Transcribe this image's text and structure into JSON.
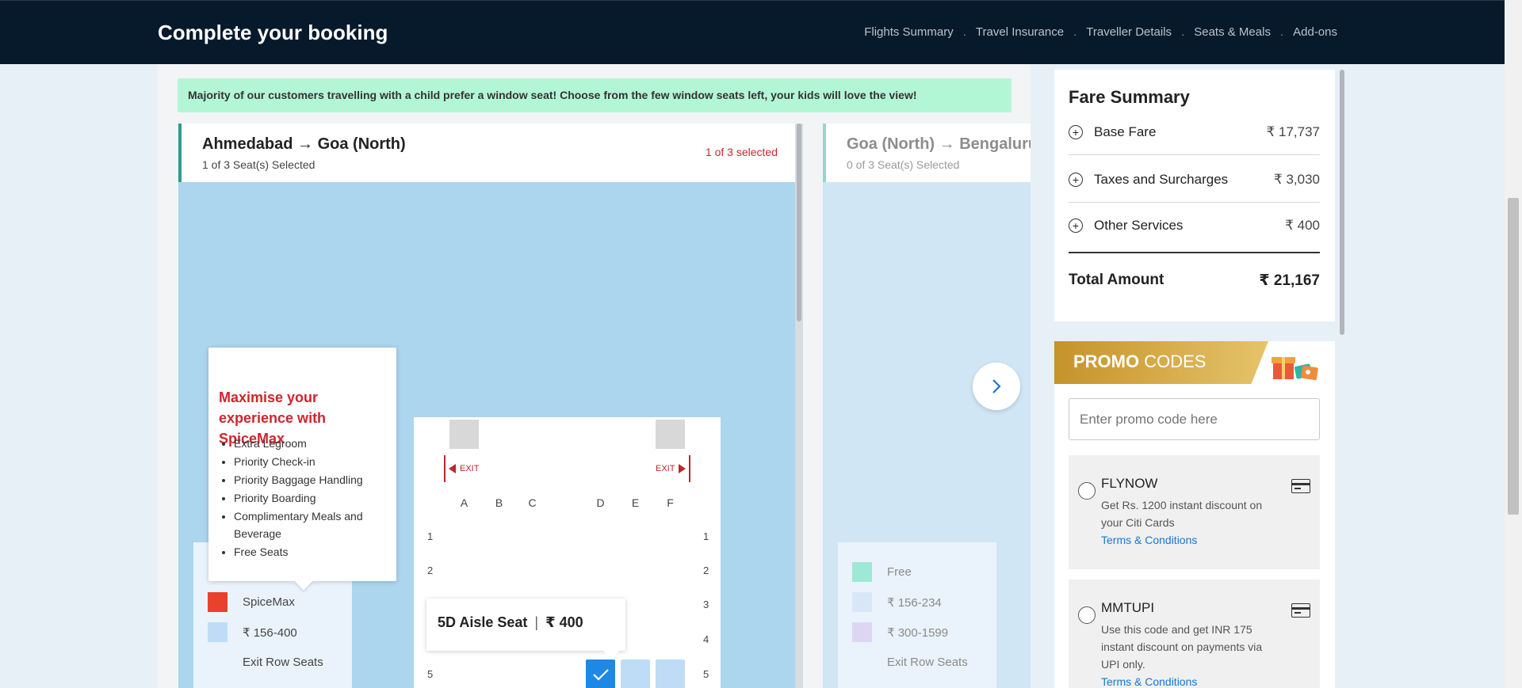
{
  "header": {
    "title": "Complete your booking",
    "steps": [
      "Flights Summary",
      "Travel Insurance",
      "Traveller Details",
      "Seats & Meals",
      "Add-ons"
    ]
  },
  "banner": "Majority of our customers travelling with a child prefer a window seat! Choose from the few window seats left, your kids will love the view!",
  "flight1": {
    "route": "Ahmedabad → Goa (North)",
    "seats_selected": "1 of 3 Seat(s) Selected",
    "selected_badge": "1 of 3 selected"
  },
  "flight2": {
    "route": "Goa (North) → Bengaluru",
    "seats_selected": "0 of 3 Seat(s) Selected"
  },
  "popover": {
    "title": "Maximise your experience with SpiceMax",
    "items": [
      "Extra Legroom",
      "Priority Check-in",
      "Priority Baggage Handling",
      "Priority Boarding",
      "Complimentary Meals and Beverage",
      "Free Seats"
    ]
  },
  "seatmap": {
    "exit_label": "EXIT",
    "columns": [
      "A",
      "B",
      "C",
      "D",
      "E",
      "F"
    ],
    "rows": [
      "1",
      "2",
      "3",
      "4",
      "5"
    ]
  },
  "seat_tooltip": {
    "seat": "5D Aisle Seat",
    "sep": "|",
    "price": "₹ 400"
  },
  "legend1": {
    "items": [
      {
        "label": "SpiceMax",
        "color": "#e8412c"
      },
      {
        "label": "₹ 156-400",
        "color": "#bfdcf7"
      },
      {
        "label": "Exit Row Seats",
        "color": ""
      }
    ]
  },
  "legend2": {
    "items": [
      {
        "label": "Free",
        "color": "#9ee8d6"
      },
      {
        "label": "₹ 156-234",
        "color": "#d8e7f8"
      },
      {
        "label": "₹ 300-1599",
        "color": "#ddd6f3"
      },
      {
        "label": "Exit Row Seats",
        "color": ""
      }
    ]
  },
  "fare": {
    "title": "Fare Summary",
    "rows": [
      {
        "label": "Base Fare",
        "value": "₹ 17,737"
      },
      {
        "label": "Taxes and Surcharges",
        "value": "₹ 3,030"
      },
      {
        "label": "Other Services",
        "value": "₹ 400"
      }
    ],
    "total_label": "Total Amount",
    "total_value": "₹ 21,167"
  },
  "promo": {
    "title_bold": "PROMO",
    "title_rest": " CODES",
    "placeholder": "Enter promo code here",
    "offers": [
      {
        "code": "FLYNOW",
        "desc": "Get Rs. 1200 instant discount on your Citi Cards",
        "tc": "Terms & Conditions"
      },
      {
        "code": "MMTUPI",
        "desc": "Use this code and get INR 175 instant discount on payments via UPI only.",
        "tc": "Terms & Conditions"
      }
    ]
  }
}
